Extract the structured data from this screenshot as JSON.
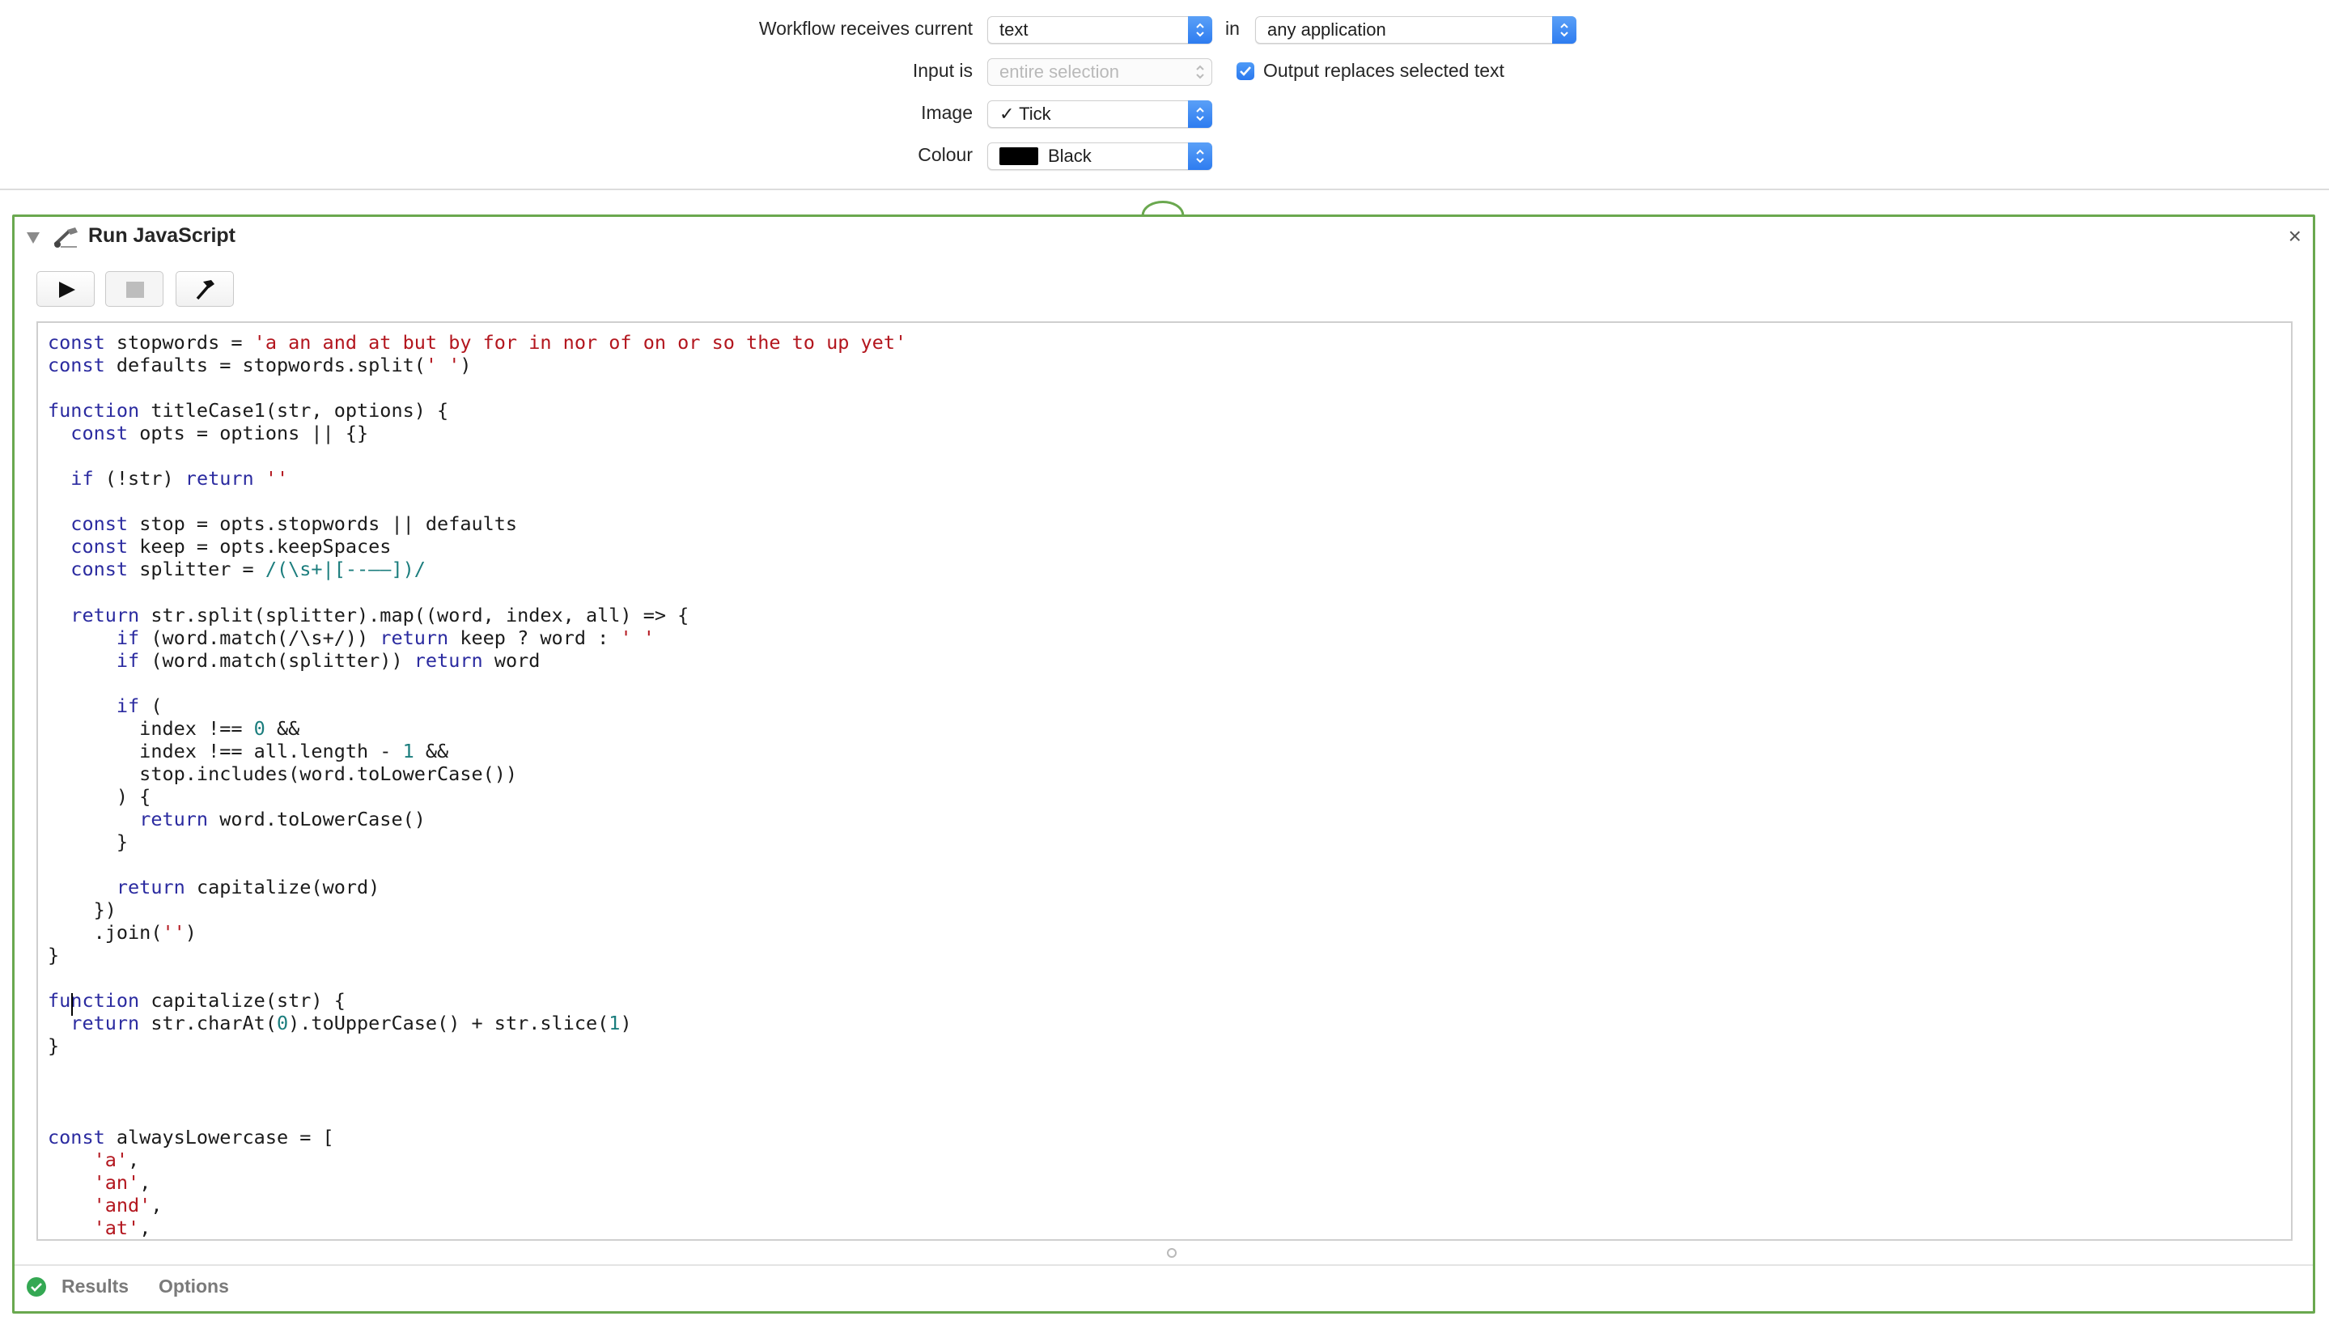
{
  "workflow": {
    "receives_label": "Workflow receives current",
    "receives_value": "text",
    "in_label": "in",
    "app_value": "any application",
    "input_label": "Input is",
    "input_value": "entire selection",
    "output_replaces_label": "Output replaces selected text",
    "output_replaces_checked": true,
    "image_label": "Image",
    "image_value": "✓ Tick",
    "colour_label": "Colour",
    "colour_value": "Black",
    "colour_swatch": "#000000"
  },
  "action": {
    "title": "Run JavaScript",
    "close_glyph": "×",
    "run_icon": "play-icon",
    "stop_icon": "stop-icon",
    "compile_icon": "hammer-icon",
    "accent": "#6aa84f",
    "footer_tabs": [
      "Results",
      "Options"
    ],
    "status_icon": "check-circle-icon"
  },
  "code_lines": [
    [
      [
        "kw",
        "const"
      ],
      [
        "",
        "stopwords = "
      ],
      [
        "str",
        "'a an and at but by for in nor of on or so the to up yet'"
      ]
    ],
    [
      [
        "kw",
        "const"
      ],
      [
        "",
        "defaults = stopwords.split("
      ],
      [
        "str",
        "' '"
      ],
      [
        "",
        ")"
      ]
    ],
    [],
    [
      [
        "kw",
        "function"
      ],
      [
        "",
        "titleCase1(str, options) {"
      ]
    ],
    [
      [
        "",
        "  "
      ],
      [
        "kw",
        "const"
      ],
      [
        "",
        "opts = options || {}"
      ]
    ],
    [],
    [
      [
        "",
        "  "
      ],
      [
        "kw",
        "if"
      ],
      [
        "",
        "(!str) "
      ],
      [
        "kw",
        "return"
      ],
      [
        "str",
        "''"
      ]
    ],
    [],
    [
      [
        "",
        "  "
      ],
      [
        "kw",
        "const"
      ],
      [
        "",
        "stop = opts.stopwords || defaults"
      ]
    ],
    [
      [
        "",
        "  "
      ],
      [
        "kw",
        "const"
      ],
      [
        "",
        "keep = opts.keepSpaces"
      ]
    ],
    [
      [
        "",
        "  "
      ],
      [
        "kw",
        "const"
      ],
      [
        "",
        "splitter = "
      ],
      [
        "re",
        "/(\\s+|[-‑–—])/"
      ]
    ],
    [],
    [
      [
        "",
        "  "
      ],
      [
        "kw",
        "return"
      ],
      [
        "",
        "str.split(splitter).map((word, index, all) => {"
      ]
    ],
    [
      [
        "",
        "      "
      ],
      [
        "kw",
        "if"
      ],
      [
        "",
        "(word.match(/\\s+/)) "
      ],
      [
        "kw",
        "return"
      ],
      [
        "",
        "keep ? word : "
      ],
      [
        "str",
        "' '"
      ]
    ],
    [
      [
        "",
        "      "
      ],
      [
        "kw",
        "if"
      ],
      [
        "",
        "(word.match(splitter)) "
      ],
      [
        "kw",
        "return"
      ],
      [
        "",
        "word"
      ]
    ],
    [],
    [
      [
        "",
        "      "
      ],
      [
        "kw",
        "if"
      ],
      [
        "",
        "("
      ]
    ],
    [
      [
        "",
        "        index !== "
      ],
      [
        "num",
        "0"
      ],
      [
        "",
        " &&"
      ]
    ],
    [
      [
        "",
        "        index !== all.length - "
      ],
      [
        "num",
        "1"
      ],
      [
        "",
        " &&"
      ]
    ],
    [
      [
        "",
        "        stop.includes(word.toLowerCase())"
      ]
    ],
    [
      [
        "",
        "      ) {"
      ]
    ],
    [
      [
        "",
        "        "
      ],
      [
        "kw",
        "return"
      ],
      [
        "",
        "word.toLowerCase()"
      ]
    ],
    [
      [
        "",
        "      }"
      ]
    ],
    [],
    [
      [
        "",
        "      "
      ],
      [
        "kw",
        "return"
      ],
      [
        "",
        "capitalize(word)"
      ]
    ],
    [
      [
        "",
        "    })"
      ]
    ],
    [
      [
        "",
        "    .join("
      ],
      [
        "str",
        "''"
      ],
      [
        "",
        ")"
      ]
    ],
    [
      [
        "",
        "}"
      ]
    ],
    [],
    [
      [
        "kw",
        "function"
      ],
      [
        "",
        "capitalize(str) {"
      ]
    ],
    [
      [
        "",
        "  "
      ],
      [
        "kw",
        "return"
      ],
      [
        "",
        "str.charAt("
      ],
      [
        "num",
        "0"
      ],
      [
        "",
        ").toUpperCase() + str.slice("
      ],
      [
        "num",
        "1"
      ],
      [
        "",
        ")"
      ]
    ],
    [
      [
        "",
        "}"
      ]
    ],
    [],
    [],
    [],
    [
      [
        "kw",
        "const"
      ],
      [
        "",
        "alwaysLowercase = ["
      ]
    ],
    [
      [
        "",
        "    "
      ],
      [
        "str",
        "'a'"
      ],
      [
        "",
        ","
      ]
    ],
    [
      [
        "",
        "    "
      ],
      [
        "str",
        "'an'"
      ],
      [
        "",
        ","
      ]
    ],
    [
      [
        "",
        "    "
      ],
      [
        "str",
        "'and'"
      ],
      [
        "",
        ","
      ]
    ],
    [
      [
        "",
        "    "
      ],
      [
        "str",
        "'at'"
      ],
      [
        "",
        ","
      ]
    ]
  ]
}
